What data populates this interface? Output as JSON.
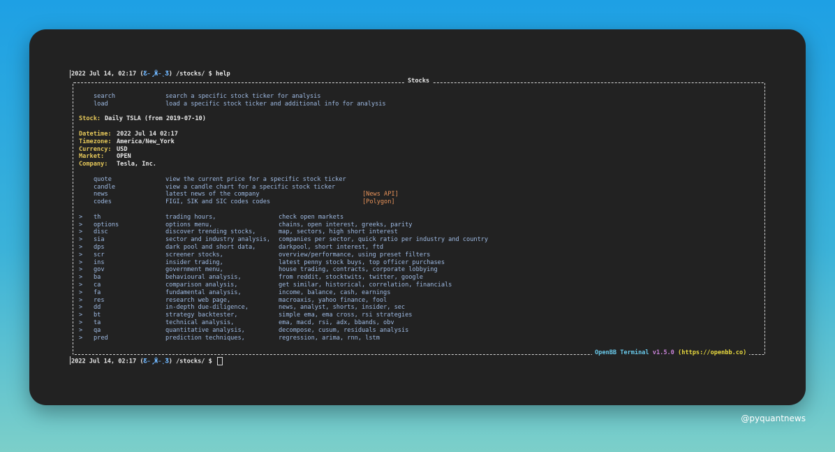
{
  "prompt_top": {
    "datetime": "2022 Jul 14, 02:17",
    "icon": "butterfly-icon",
    "path": "/stocks/ $",
    "command": "help"
  },
  "panel": {
    "title": "Stocks",
    "footer": {
      "name": "OpenBB Terminal",
      "version": "v1.5.0",
      "url": "(https://openbb.co)"
    }
  },
  "top_commands": [
    {
      "cmd": "search",
      "desc": "search a specific stock ticker for analysis"
    },
    {
      "cmd": "load",
      "desc": "load a specific stock ticker and additional info for analysis"
    }
  ],
  "stock_line": {
    "label": "Stock:",
    "value": "Daily TSLA (from 2019-07-10)"
  },
  "info": [
    {
      "label": "Datetime:",
      "value": "2022 Jul 14 02:17"
    },
    {
      "label": "Timezone:",
      "value": "America/New_York"
    },
    {
      "label": "Currency:",
      "value": "USD"
    },
    {
      "label": "Market:  ",
      "value": "OPEN"
    },
    {
      "label": "Company: ",
      "value": "Tesla, Inc."
    }
  ],
  "stock_commands": [
    {
      "cmd": "quote",
      "desc": "view the current price for a specific stock ticker",
      "tag": ""
    },
    {
      "cmd": "candle",
      "desc": "view a candle chart for a specific stock ticker",
      "tag": ""
    },
    {
      "cmd": "news",
      "desc": "latest news of the company",
      "tag": "[News API]"
    },
    {
      "cmd": "codes",
      "desc": "FIGI, SIK and SIC codes codes",
      "tag": "[Polygon]"
    }
  ],
  "menus": [
    {
      "arrow": ">",
      "cmd": "th",
      "desc": "trading hours,",
      "detail": "check open markets"
    },
    {
      "arrow": ">",
      "cmd": "options",
      "desc": "options menu,",
      "detail": "chains, open interest, greeks, parity"
    },
    {
      "arrow": ">",
      "cmd": "disc",
      "desc": "discover trending stocks,",
      "detail": "map, sectors, high short interest"
    },
    {
      "arrow": ">",
      "cmd": "sia",
      "desc": "sector and industry analysis,",
      "detail": "companies per sector, quick ratio per industry and country"
    },
    {
      "arrow": ">",
      "cmd": "dps",
      "desc": "dark pool and short data,",
      "detail": "darkpool, short interest, ftd"
    },
    {
      "arrow": ">",
      "cmd": "scr",
      "desc": "screener stocks,",
      "detail": "overview/performance, using preset filters"
    },
    {
      "arrow": ">",
      "cmd": "ins",
      "desc": "insider trading,",
      "detail": "latest penny stock buys, top officer purchases"
    },
    {
      "arrow": ">",
      "cmd": "gov",
      "desc": "government menu,",
      "detail": "house trading, contracts, corporate lobbying"
    },
    {
      "arrow": ">",
      "cmd": "ba",
      "desc": "behavioural analysis,",
      "detail": "from reddit, stocktwits, twitter, google"
    },
    {
      "arrow": ">",
      "cmd": "ca",
      "desc": "comparison analysis,",
      "detail": "get similar, historical, correlation, financials"
    },
    {
      "arrow": ">",
      "cmd": "fa",
      "desc": "fundamental analysis,",
      "detail": "income, balance, cash, earnings"
    },
    {
      "arrow": ">",
      "cmd": "res",
      "desc": "research web page,",
      "detail": "macroaxis, yahoo finance, fool"
    },
    {
      "arrow": ">",
      "cmd": "dd",
      "desc": "in-depth due-diligence,",
      "detail": "news, analyst, shorts, insider, sec"
    },
    {
      "arrow": ">",
      "cmd": "bt",
      "desc": "strategy backtester,",
      "detail": "simple ema, ema cross, rsi strategies"
    },
    {
      "arrow": ">",
      "cmd": "ta",
      "desc": "technical analysis,",
      "detail": "ema, macd, rsi, adx, bbands, obv"
    },
    {
      "arrow": ">",
      "cmd": "qa",
      "desc": "quantitative analysis,",
      "detail": "decompose, cusum, residuals analysis"
    },
    {
      "arrow": ">",
      "cmd": "pred",
      "desc": "prediction techniques,",
      "detail": "regression, arima, rnn, lstm"
    }
  ],
  "prompt_bottom": {
    "datetime": "2022 Jul 14, 02:17",
    "path": "/stocks/ $"
  },
  "watermark": "@pyquantnews"
}
